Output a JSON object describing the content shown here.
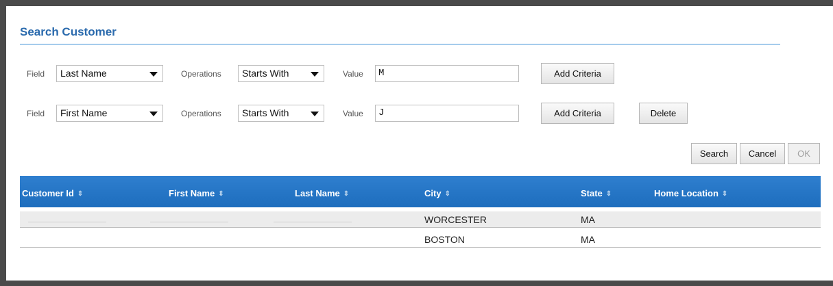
{
  "title": "Search Customer",
  "criteria": [
    {
      "field_label": "Field",
      "field_value": "Last Name",
      "ops_label": "Operations",
      "ops_value": "Starts With",
      "value_label": "Value",
      "value": "M",
      "add_label": "Add Criteria"
    },
    {
      "field_label": "Field",
      "field_value": "First Name",
      "ops_label": "Operations",
      "ops_value": "Starts With",
      "value_label": "Value",
      "value": "J",
      "add_label": "Add Criteria",
      "delete_label": "Delete"
    }
  ],
  "actions": {
    "search": "Search",
    "cancel": "Cancel",
    "ok": "OK"
  },
  "grid": {
    "columns": [
      "Customer Id",
      "First Name",
      "Last Name",
      "City",
      "State",
      "Home Location"
    ],
    "rows": [
      {
        "customer_id": "",
        "first_name": "",
        "last_name": "",
        "city": "WORCESTER",
        "state": "MA",
        "home_location": ""
      },
      {
        "customer_id": "",
        "first_name": "",
        "last_name": "",
        "city": "BOSTON",
        "state": "MA",
        "home_location": ""
      }
    ]
  },
  "colors": {
    "accent": "#2a6aad",
    "header_bg": "#1d6dbd"
  },
  "icons": {
    "dropdown": "chevron-down-icon",
    "sort": "sort-icon"
  }
}
